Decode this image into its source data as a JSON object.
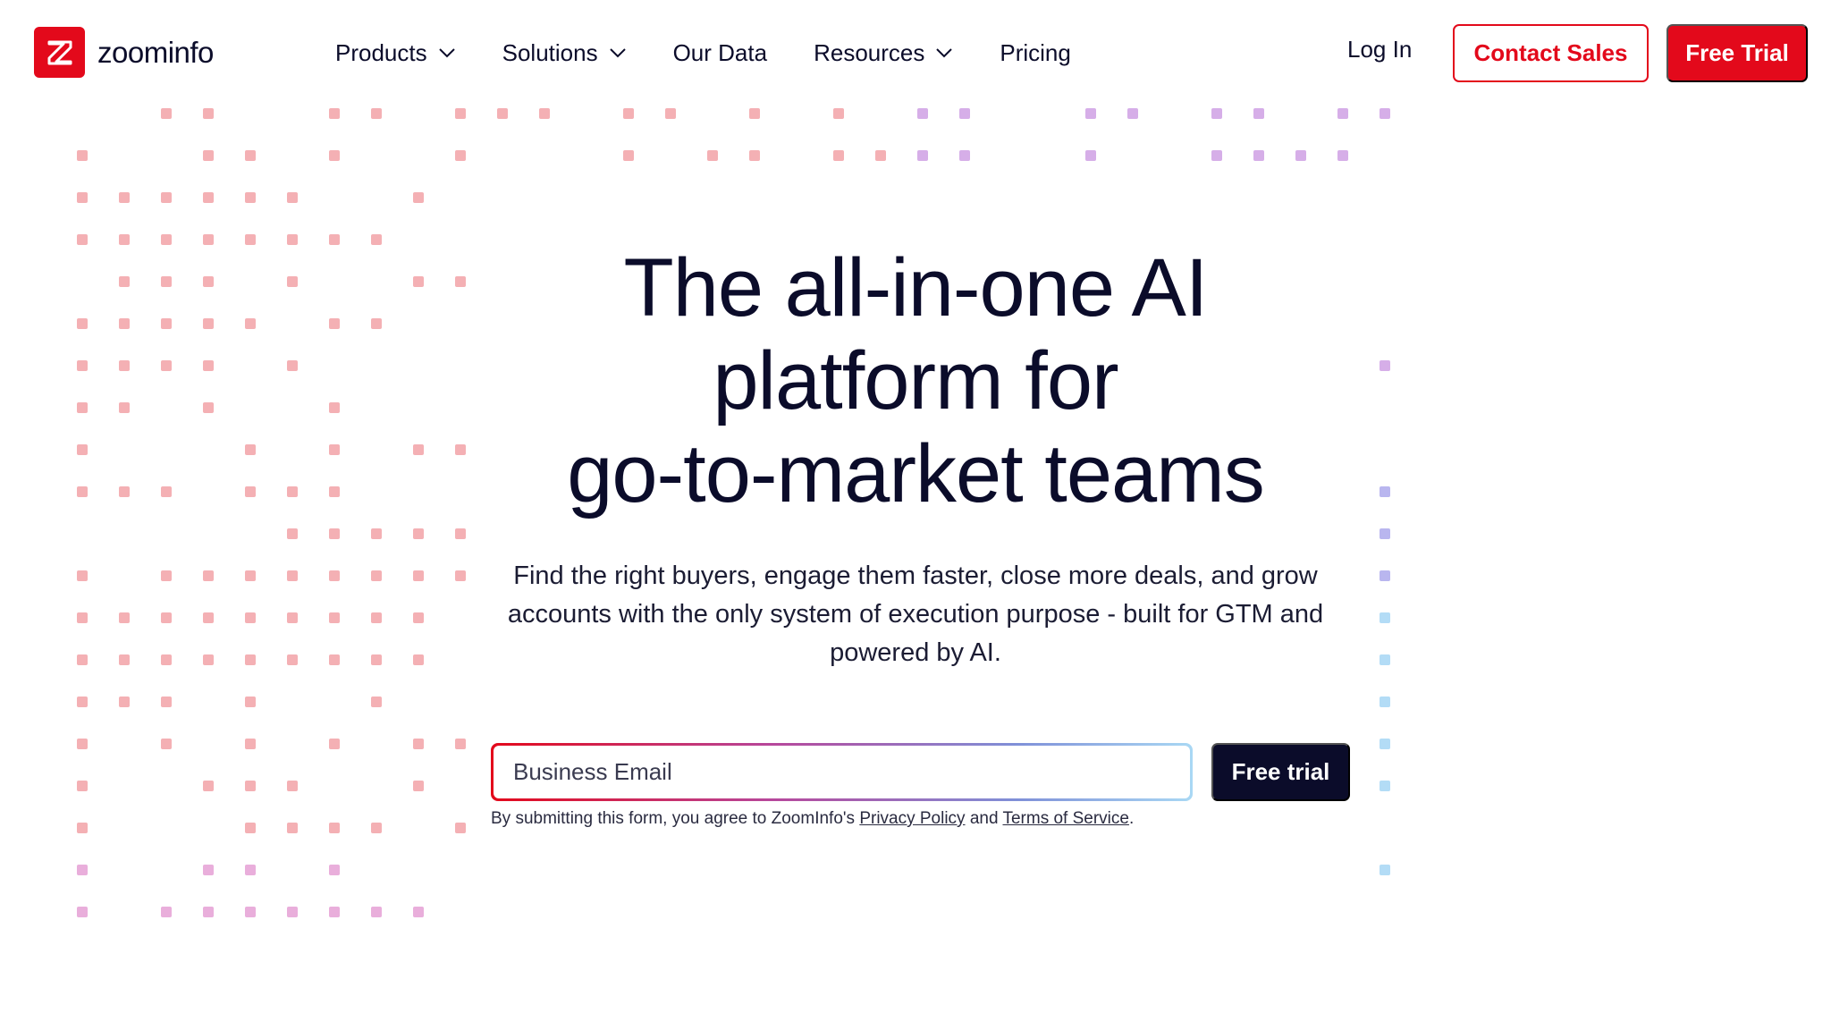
{
  "brand": {
    "name": "zoominfo",
    "accent_color": "#e3091b",
    "dark_color": "#0b0c2a"
  },
  "nav": {
    "items": [
      {
        "label": "Products",
        "has_dropdown": true,
        "icon": "chevron-down-icon"
      },
      {
        "label": "Solutions",
        "has_dropdown": true,
        "icon": "chevron-down-icon"
      },
      {
        "label": "Our Data",
        "has_dropdown": false
      },
      {
        "label": "Resources",
        "has_dropdown": true,
        "icon": "chevron-down-icon"
      },
      {
        "label": "Pricing",
        "has_dropdown": false
      }
    ],
    "login_label": "Log In",
    "contact_label": "Contact Sales",
    "trial_label": "Free Trial"
  },
  "hero": {
    "title_line1": "The all-in-one AI",
    "title_line2": "platform for",
    "title_line3": "go-to-market teams",
    "subtitle": "Find the right buyers, engage them faster, close more deals, and grow accounts with the only system of execution purpose - built for GTM and powered by AI.",
    "email_placeholder": "Business Email",
    "cta_label": "Free trial",
    "disclaimer_prefix": "By submitting this form, you agree to ZoomInfo's ",
    "privacy_label": "Privacy Policy",
    "disclaimer_and": " and ",
    "terms_label": "Terms of Service",
    "disclaimer_suffix": "."
  },
  "decoration": {
    "dot_colors": {
      "left": "#f4b0b4",
      "left_bottom": "#e9aedb",
      "right_top": "#d6aee8",
      "right_mid": "#b9b6ef",
      "right_bottom": "#b3dcf6"
    }
  }
}
